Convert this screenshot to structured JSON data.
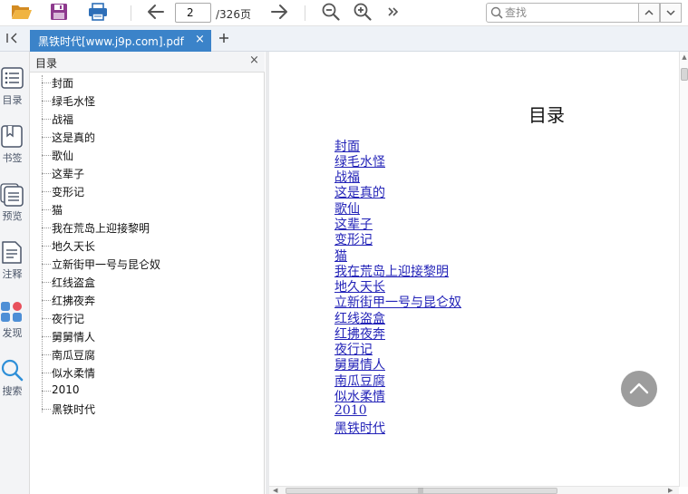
{
  "toolbar": {
    "current_page": "2",
    "page_total": "/326页",
    "search_placeholder": "查找",
    "icons": [
      "folder-open-icon",
      "save-icon",
      "print-icon",
      "arrow-left-icon",
      "arrow-right-icon",
      "zoom-out-icon",
      "zoom-in-icon",
      "more-icon",
      "search-icon",
      "chevron-up-icon",
      "chevron-down-icon"
    ]
  },
  "tabs": {
    "active_title": "黑铁时代[www.j9p.com].pdf",
    "close_glyph": "×",
    "new_tab_glyph": "+"
  },
  "rail": {
    "items": [
      {
        "label": "目录",
        "icon": "toc-icon"
      },
      {
        "label": "书签",
        "icon": "bookmark-icon"
      },
      {
        "label": "预览",
        "icon": "thumbnail-icon"
      },
      {
        "label": "注释",
        "icon": "annotation-icon"
      },
      {
        "label": "发现",
        "icon": "discover-icon"
      },
      {
        "label": "搜索",
        "icon": "search-icon"
      }
    ]
  },
  "outline": {
    "title": "目录",
    "close_glyph": "×",
    "items": [
      "封面",
      "绿毛水怪",
      "战福",
      "这是真的",
      "歌仙",
      "这辈子",
      "变形记",
      "猫",
      "我在荒岛上迎接黎明",
      "地久天长",
      "立新街甲一号与昆仑奴",
      "红线盗盒",
      "红拂夜奔",
      "夜行记",
      "舅舅情人",
      "南瓜豆腐",
      "似水柔情",
      "2010",
      "黑铁时代"
    ]
  },
  "document": {
    "heading": "目录",
    "links": [
      "封面",
      "绿毛水怪",
      "战福",
      "这是真的",
      "歌仙",
      "这辈子",
      "变形记",
      "猫",
      "我在荒岛上迎接黎明",
      "地久天长",
      "立新街甲一号与昆仑奴",
      "红线盗盒",
      "红拂夜奔",
      "夜行记",
      "舅舅情人",
      "南瓜豆腐",
      "似水柔情",
      "2010",
      "黑铁时代"
    ],
    "link_color": "#2424b8"
  },
  "colors": {
    "accent": "#3b83c9",
    "folder": "#e8a33a",
    "save": "#8e3a8e",
    "print": "#2e6fb8"
  }
}
